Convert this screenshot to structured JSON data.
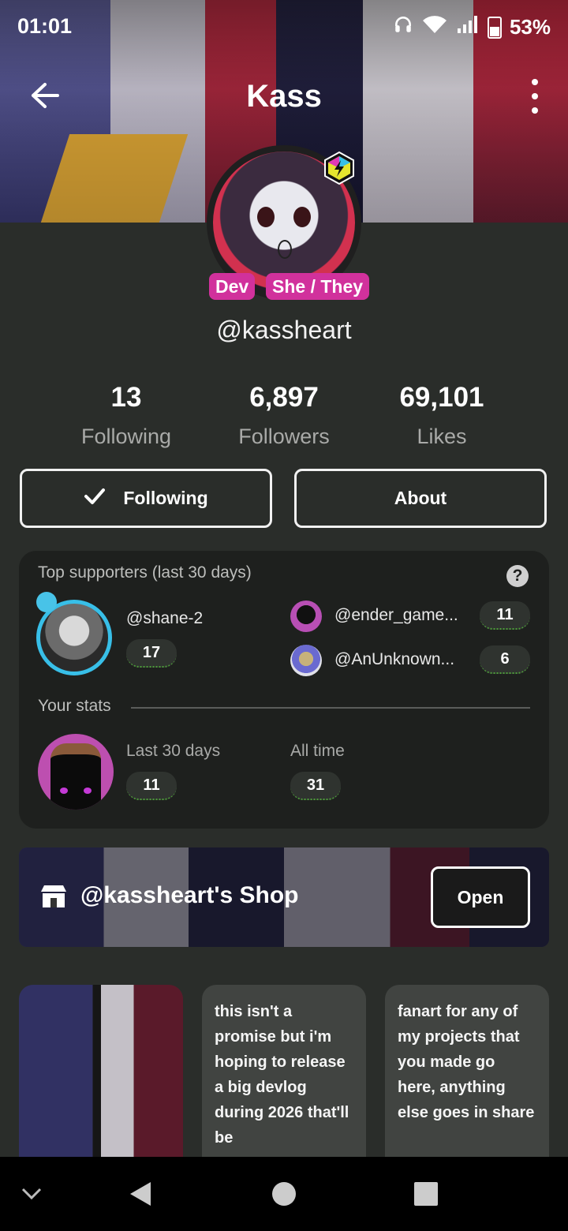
{
  "status": {
    "time": "01:01",
    "battery": "53%"
  },
  "header": {
    "title": "Kass"
  },
  "profile": {
    "handle": "@kassheart",
    "pills": [
      "Dev",
      "She / They"
    ]
  },
  "stats": [
    {
      "value": "13",
      "label": "Following"
    },
    {
      "value": "6,897",
      "label": "Followers"
    },
    {
      "value": "69,101",
      "label": "Likes"
    }
  ],
  "actions": {
    "following_label": "Following",
    "about_label": "About"
  },
  "supporters": {
    "title": "Top supporters (last 30 days)",
    "help": "?",
    "top": {
      "name": "@shane-2",
      "count": "17"
    },
    "others": [
      {
        "name": "@ender_game...",
        "count": "11"
      },
      {
        "name": "@AnUnknown...",
        "count": "6"
      }
    ],
    "your_stats_title": "Your stats",
    "last30_label": "Last 30 days",
    "last30_value": "11",
    "alltime_label": "All time",
    "alltime_value": "31"
  },
  "shop": {
    "name": "@kassheart's Shop",
    "open_label": "Open"
  },
  "posts": [
    {
      "text": "this isn't a promise but i'm hoping to release a big devlog during 2026 that'll be"
    },
    {
      "text": "fanart for any of my projects that you made go here, anything else goes in share"
    }
  ],
  "colors": {
    "pill": "#d1319c",
    "accent_ring": "#38bfe8",
    "background": "#2a2d2a"
  }
}
